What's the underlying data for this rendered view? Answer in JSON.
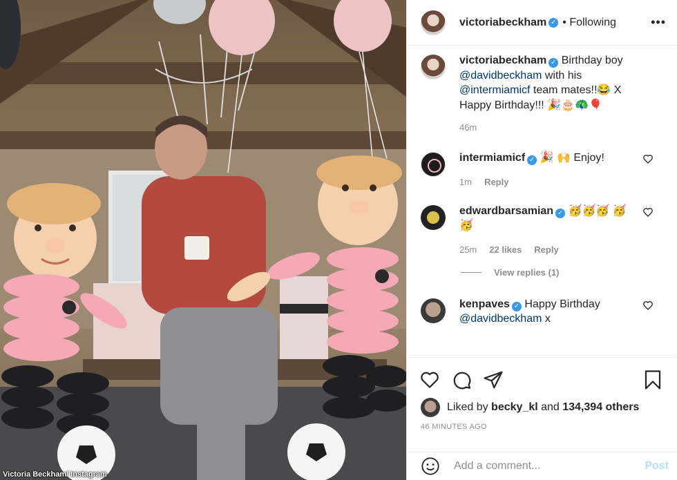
{
  "photo": {
    "alt_description": "",
    "credit": "Victoria Beckham/ Instagram"
  },
  "header": {
    "username": "victoriabeckham",
    "verified": true,
    "follow_status": "• Following",
    "more_icon": "more-options-icon"
  },
  "caption": {
    "username": "victoriabeckham",
    "text_before": "Birthday boy ",
    "mention1": "@davidbeckham",
    "text_middle": " with his ",
    "mention2": "@intermiamicf",
    "text_after": " team mates!!😂 X Happy Birthday!!! 🎉🎂🦚🎈",
    "time": "46m"
  },
  "comments": [
    {
      "username": "intermiamicf",
      "verified": true,
      "text": "🎉 🙌 Enjoy!",
      "time": "1m",
      "reply": "Reply"
    },
    {
      "username": "edwardbarsamian",
      "verified": true,
      "text": "🥳🥳🥳 🥳🥳",
      "time": "25m",
      "likes": "22 likes",
      "reply": "Reply",
      "view_replies": "View replies (1)"
    },
    {
      "username": "kenpaves",
      "verified": true,
      "text": "Happy Birthday ",
      "mention": "@davidbeckham",
      "text_after": " x"
    }
  ],
  "likes": {
    "prefix": "Liked by ",
    "user": "becky_kl",
    "middle": " and ",
    "count": "134,394 others"
  },
  "timestamp": "46 MINUTES AGO",
  "add_comment": {
    "placeholder": "Add a comment...",
    "post_label": "Post"
  },
  "colors": {
    "link": "#00376b",
    "verified": "#3897f0",
    "muted": "#8e8e8e",
    "post_disabled": "#b2dffc"
  }
}
